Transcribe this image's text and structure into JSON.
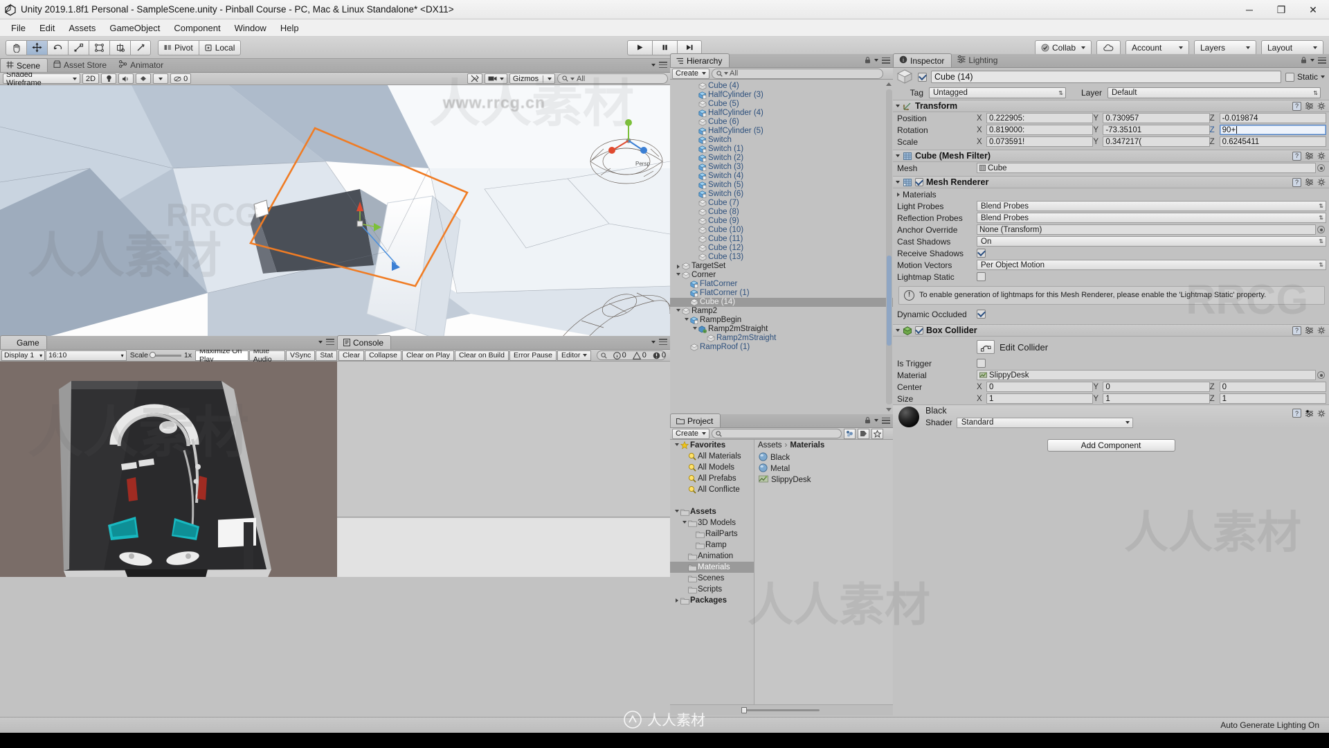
{
  "window": {
    "title": "Unity 2019.1.8f1 Personal - SampleScene.unity - Pinball Course - PC, Mac & Linux Standalone* <DX11>",
    "minimize": "─",
    "maximize": "❐",
    "close": "✕"
  },
  "menu": {
    "items": [
      "File",
      "Edit",
      "Assets",
      "GameObject",
      "Component",
      "Window",
      "Help"
    ]
  },
  "toolbar": {
    "tools": [
      "hand-tool",
      "move-tool",
      "rotate-tool",
      "scale-tool",
      "rect-tool",
      "transform-tool",
      "custom-tool"
    ],
    "pivot_label": "Pivot",
    "local_label": "Local",
    "play": "▶",
    "pause": "‖",
    "step": "▶|",
    "collab_label": "Collab",
    "cloud_label": "cloud-icon",
    "account_label": "Account",
    "layers_label": "Layers",
    "layout_label": "Layout"
  },
  "scene": {
    "tabs": [
      {
        "label": "Scene",
        "icon": "scene-grid-icon",
        "active": true
      },
      {
        "label": "Asset Store",
        "icon": "store-icon",
        "active": false
      },
      {
        "label": "Animator",
        "icon": "animator-icon",
        "active": false
      }
    ],
    "draw_mode": "Shaded Wireframe",
    "two_d": "2D",
    "light_toggle": "light-icon",
    "audio_toggle": "audio-icon",
    "fx_toggle": "fx-icon",
    "effects_count": "0",
    "gizmos_label": "Gizmos",
    "search_placeholder": "All",
    "camera_icon": "camera-icon",
    "tools_icon": "tools-icon"
  },
  "game": {
    "tab_label": "Game",
    "display": "Display 1",
    "aspect": "16:10",
    "scale_label": "Scale",
    "scale_value": "1x",
    "maximize_on_play": "Maximize On Play",
    "mute_audio": "Mute Audio",
    "vsync": "VSync",
    "stats": "Stat"
  },
  "console": {
    "tab_label": "Console",
    "buttons": [
      "Clear",
      "Collapse",
      "Clear on Play",
      "Clear on Build",
      "Error Pause"
    ],
    "editor_label": "Editor",
    "search_placeholder": "",
    "counts": {
      "log": "0",
      "warning": "0",
      "error": "0"
    }
  },
  "hierarchy": {
    "tab_label": "Hierarchy",
    "create_label": "Create",
    "search_placeholder": "All",
    "items": [
      {
        "label": "Cube (4)",
        "indent": 3,
        "icon": "cube",
        "expand": "none",
        "selected": false
      },
      {
        "label": "HalfCylinder (3)",
        "indent": 3,
        "icon": "prefab",
        "expand": "none",
        "selected": false
      },
      {
        "label": "Cube (5)",
        "indent": 3,
        "icon": "cube",
        "expand": "none",
        "selected": false
      },
      {
        "label": "HalfCylinder (4)",
        "indent": 3,
        "icon": "prefab",
        "expand": "none",
        "selected": false
      },
      {
        "label": "Cube (6)",
        "indent": 3,
        "icon": "cube",
        "expand": "none",
        "selected": false
      },
      {
        "label": "HalfCylinder (5)",
        "indent": 3,
        "icon": "prefab",
        "expand": "none",
        "selected": false
      },
      {
        "label": "Switch",
        "indent": 3,
        "icon": "prefab",
        "expand": "none",
        "selected": false
      },
      {
        "label": "Switch (1)",
        "indent": 3,
        "icon": "prefab",
        "expand": "none",
        "selected": false
      },
      {
        "label": "Switch (2)",
        "indent": 3,
        "icon": "prefab",
        "expand": "none",
        "selected": false
      },
      {
        "label": "Switch (3)",
        "indent": 3,
        "icon": "prefab",
        "expand": "none",
        "selected": false
      },
      {
        "label": "Switch (4)",
        "indent": 3,
        "icon": "prefab",
        "expand": "none",
        "selected": false
      },
      {
        "label": "Switch (5)",
        "indent": 3,
        "icon": "prefab",
        "expand": "none",
        "selected": false
      },
      {
        "label": "Switch (6)",
        "indent": 3,
        "icon": "prefab",
        "expand": "none",
        "selected": false
      },
      {
        "label": "Cube (7)",
        "indent": 3,
        "icon": "cube",
        "expand": "none",
        "selected": false
      },
      {
        "label": "Cube (8)",
        "indent": 3,
        "icon": "cube",
        "expand": "none",
        "selected": false
      },
      {
        "label": "Cube (9)",
        "indent": 3,
        "icon": "cube",
        "expand": "none",
        "selected": false
      },
      {
        "label": "Cube (10)",
        "indent": 3,
        "icon": "cube",
        "expand": "none",
        "selected": false
      },
      {
        "label": "Cube (11)",
        "indent": 3,
        "icon": "cube",
        "expand": "none",
        "selected": false
      },
      {
        "label": "Cube (12)",
        "indent": 3,
        "icon": "cube",
        "expand": "none",
        "selected": false
      },
      {
        "label": "Cube (13)",
        "indent": 3,
        "icon": "cube",
        "expand": "none",
        "selected": false
      },
      {
        "label": "TargetSet",
        "indent": 1,
        "icon": "cube",
        "expand": "collapsed",
        "selected": false
      },
      {
        "label": "Corner",
        "indent": 1,
        "icon": "cube",
        "expand": "expanded",
        "selected": false
      },
      {
        "label": "FlatCorner",
        "indent": 2,
        "icon": "prefab",
        "expand": "none",
        "selected": false
      },
      {
        "label": "FlatCorner (1)",
        "indent": 2,
        "icon": "prefab",
        "expand": "none",
        "selected": false
      },
      {
        "label": "Cube (14)",
        "indent": 2,
        "icon": "cube",
        "expand": "none",
        "selected": true
      },
      {
        "label": "Ramp2",
        "indent": 1,
        "icon": "cube",
        "expand": "expanded",
        "selected": false
      },
      {
        "label": "RampBegin",
        "indent": 2,
        "icon": "prefab",
        "expand": "expanded",
        "selected": false
      },
      {
        "label": "Ramp2mStraight",
        "indent": 3,
        "icon": "model",
        "expand": "expanded",
        "selected": false
      },
      {
        "label": "Ramp2mStraight",
        "indent": 4,
        "icon": "cube",
        "expand": "none",
        "selected": false
      },
      {
        "label": "RampRoof (1)",
        "indent": 2,
        "icon": "cube",
        "expand": "none",
        "selected": false
      }
    ]
  },
  "project": {
    "tab_label": "Project",
    "create_label": "Create",
    "search_placeholder": "",
    "breadcrumb": [
      "Assets",
      "Materials"
    ],
    "tree": [
      {
        "label": "Favorites",
        "indent": 0,
        "icon": "star",
        "expand": "expanded",
        "bold": true,
        "selected": false
      },
      {
        "label": "All Materials",
        "indent": 1,
        "icon": "search",
        "expand": "none",
        "bold": false,
        "selected": false
      },
      {
        "label": "All Models",
        "indent": 1,
        "icon": "search",
        "expand": "none",
        "bold": false,
        "selected": false
      },
      {
        "label": "All Prefabs",
        "indent": 1,
        "icon": "search",
        "expand": "none",
        "bold": false,
        "selected": false
      },
      {
        "label": "All Conflicte",
        "indent": 1,
        "icon": "search",
        "expand": "none",
        "bold": false,
        "selected": false
      },
      {
        "label": "",
        "indent": 0,
        "icon": "none",
        "expand": "none",
        "bold": false,
        "selected": false
      },
      {
        "label": "Assets",
        "indent": 0,
        "icon": "folder",
        "expand": "expanded",
        "bold": true,
        "selected": false
      },
      {
        "label": "3D Models",
        "indent": 1,
        "icon": "folder",
        "expand": "expanded",
        "bold": false,
        "selected": false
      },
      {
        "label": "RailParts",
        "indent": 2,
        "icon": "folder",
        "expand": "none",
        "bold": false,
        "selected": false
      },
      {
        "label": "Ramp",
        "indent": 2,
        "icon": "folder",
        "expand": "none",
        "bold": false,
        "selected": false
      },
      {
        "label": "Animation",
        "indent": 1,
        "icon": "folder",
        "expand": "none",
        "bold": false,
        "selected": false
      },
      {
        "label": "Materials",
        "indent": 1,
        "icon": "folder",
        "expand": "none",
        "bold": false,
        "selected": true
      },
      {
        "label": "Scenes",
        "indent": 1,
        "icon": "folder",
        "expand": "none",
        "bold": false,
        "selected": false
      },
      {
        "label": "Scripts",
        "indent": 1,
        "icon": "folder",
        "expand": "none",
        "bold": false,
        "selected": false
      },
      {
        "label": "Packages",
        "indent": 0,
        "icon": "folder",
        "expand": "collapsed",
        "bold": true,
        "selected": false
      }
    ],
    "assets": [
      {
        "label": "Black",
        "icon": "material-sphere"
      },
      {
        "label": "Metal",
        "icon": "material-sphere"
      },
      {
        "label": "SlippyDesk",
        "icon": "physic-material"
      }
    ]
  },
  "inspector": {
    "tabs": [
      {
        "label": "Inspector",
        "icon": "info-icon",
        "active": true
      },
      {
        "label": "Lighting",
        "icon": "lighting-icon",
        "active": false
      }
    ],
    "object_name": "Cube (14)",
    "object_enabled": true,
    "static_label": "Static",
    "static_checked": false,
    "tag_label": "Tag",
    "tag_value": "Untagged",
    "layer_label": "Layer",
    "layer_value": "Default",
    "transform": {
      "title": "Transform",
      "rows": [
        {
          "label": "Position",
          "x": "0.222905:",
          "y": "0.730957",
          "z": "-0.019874",
          "focused": "none"
        },
        {
          "label": "Rotation",
          "x": "0.819000:",
          "y": "-73.35101",
          "z": "90+",
          "focused": "z"
        },
        {
          "label": "Scale",
          "x": "0.073591!",
          "y": "0.347217(",
          "z": "0.6245411",
          "focused": "none"
        }
      ]
    },
    "mesh_filter": {
      "title": "Cube (Mesh Filter)",
      "mesh_label": "Mesh",
      "mesh_value": "Cube"
    },
    "mesh_renderer": {
      "title": "Mesh Renderer",
      "enabled": true,
      "materials_label": "Materials",
      "rows": [
        {
          "label": "Light Probes",
          "value": "Blend Probes",
          "type": "dropdown"
        },
        {
          "label": "Reflection Probes",
          "value": "Blend Probes",
          "type": "dropdown"
        },
        {
          "label": "Anchor Override",
          "value": "None (Transform)",
          "type": "object"
        },
        {
          "label": "Cast Shadows",
          "value": "On",
          "type": "dropdown"
        },
        {
          "label": "Receive Shadows",
          "value": "",
          "type": "checkbox",
          "checked": true
        },
        {
          "label": "Motion Vectors",
          "value": "Per Object Motion",
          "type": "dropdown"
        },
        {
          "label": "Lightmap Static",
          "value": "",
          "type": "checkbox",
          "checked": false
        }
      ],
      "help_text": "To enable generation of lightmaps for this Mesh Renderer, please enable the 'Lightmap Static' property.",
      "dynamic_occluded_label": "Dynamic Occluded",
      "dynamic_occluded_checked": true
    },
    "box_collider": {
      "title": "Box Collider",
      "enabled": true,
      "edit_collider_label": "Edit Collider",
      "is_trigger_label": "Is Trigger",
      "is_trigger_checked": false,
      "material_label": "Material",
      "material_value": "SlippyDesk",
      "center_label": "Center",
      "center": {
        "x": "0",
        "y": "0",
        "z": "0"
      },
      "size_label": "Size",
      "size": {
        "x": "1",
        "y": "1",
        "z": "1"
      }
    },
    "material": {
      "name": "Black",
      "shader_label": "Shader",
      "shader_value": "Standard"
    },
    "add_component_label": "Add Component"
  },
  "status": {
    "text": "Auto Generate Lighting On"
  },
  "watermarks": {
    "site": "www.rrcg.cn",
    "brand": "RRCG",
    "cn": "人人素材",
    "logo": "人人素材"
  }
}
